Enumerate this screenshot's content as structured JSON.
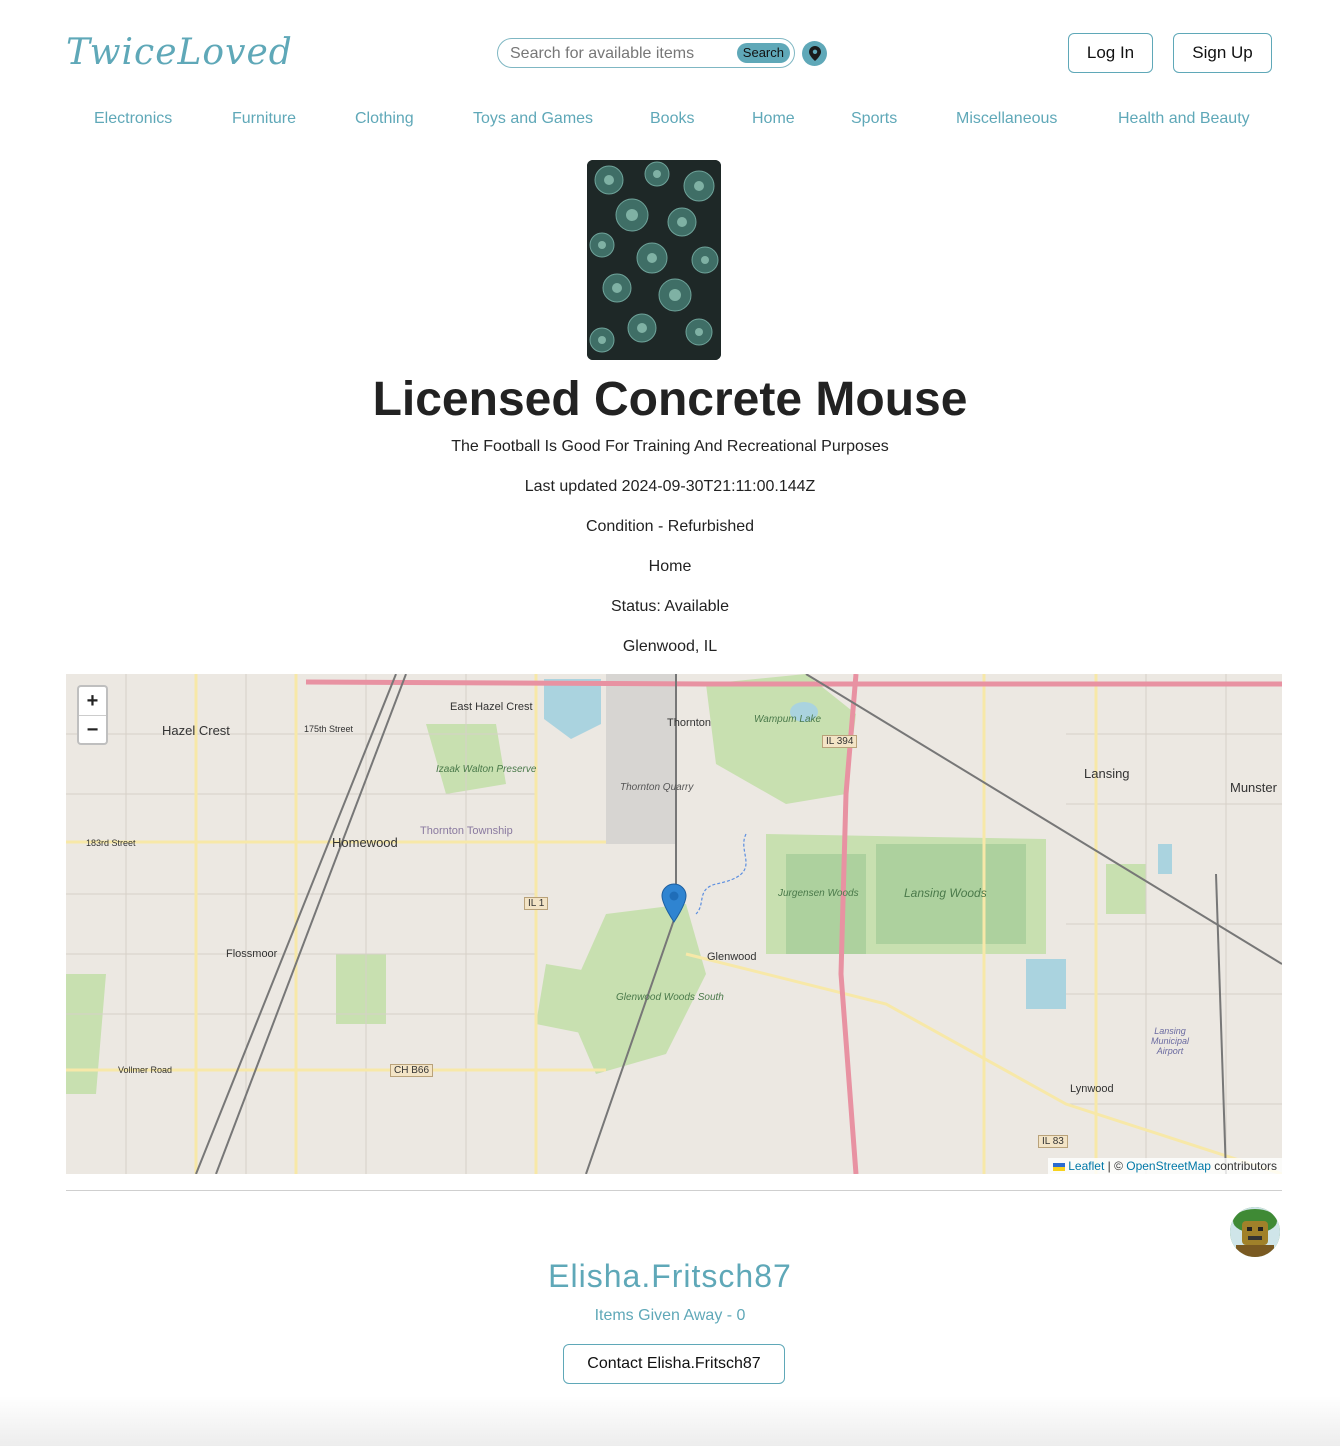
{
  "header": {
    "logo_text": "TwiceLoved",
    "search": {
      "placeholder": "Search for available items",
      "button_label": "Search"
    },
    "login_label": "Log In",
    "signup_label": "Sign Up",
    "accent_color": "#5fa8b8"
  },
  "nav": {
    "items": [
      {
        "label": "Electronics"
      },
      {
        "label": "Furniture"
      },
      {
        "label": "Clothing"
      },
      {
        "label": "Toys and Games"
      },
      {
        "label": "Books"
      },
      {
        "label": "Home"
      },
      {
        "label": "Sports"
      },
      {
        "label": "Miscellaneous"
      },
      {
        "label": "Health and Beauty"
      }
    ]
  },
  "item": {
    "title": "Licensed Concrete Mouse",
    "description": "The Football Is Good For Training And Recreational Purposes",
    "last_updated": "Last updated 2024-09-30T21:11:00.144Z",
    "condition": "Condition - Refurbished",
    "category": "Home",
    "status": "Status: Available",
    "location": "Glenwood, IL"
  },
  "map": {
    "zoom_in": "+",
    "zoom_out": "−",
    "attribution": {
      "leaflet": "Leaflet",
      "separator": " | © ",
      "osm": "OpenStreetMap",
      "suffix": " contributors"
    },
    "labels": {
      "hazel_crest": "Hazel Crest",
      "east_hazel_crest": "East Hazel Crest",
      "thornton": "Thornton",
      "homewood": "Homewood",
      "flossmoor": "Flossmoor",
      "glenwood": "Glenwood",
      "lansing": "Lansing",
      "munster": "Munster",
      "lynwood": "Lynwood",
      "thornton_quarry": "Thornton Quarry",
      "wampum_lake": "Wampum Lake",
      "lansing_woods": "Lansing Woods",
      "jurgensen_woods": "Jurgensen Woods",
      "izaak_walton": "Izaak Walton Preserve",
      "glenwood_woods": "Glenwood Woods South",
      "thornton_township": "Thornton Township",
      "vollmer_road": "Vollmer Road",
      "street_183": "183rd Street",
      "street_175": "175th Street",
      "il_394": "IL 394",
      "il_1": "IL 1",
      "ch_b66": "CH B66",
      "il_83": "IL 83",
      "lansing_airport": "Lansing Municipal Airport"
    }
  },
  "seller": {
    "username": "Elisha.Fritsch87",
    "items_given": "Items Given Away - 0",
    "contact_label": "Contact Elisha.Fritsch87"
  }
}
